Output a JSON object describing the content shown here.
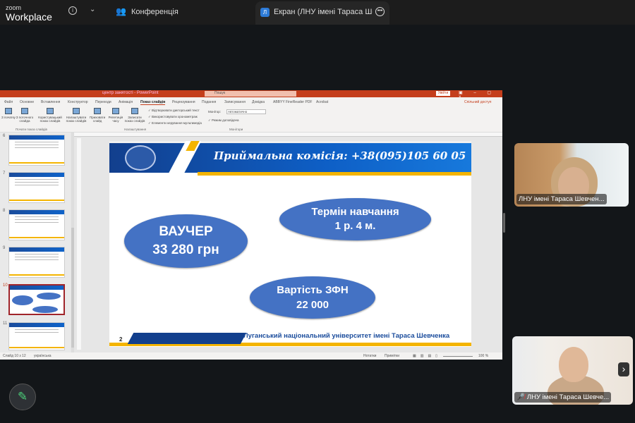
{
  "zoom": {
    "logo_small": "zoom",
    "logo_big": "Workplace",
    "meeting_label": "Конференція",
    "share_tab_initial": "Л",
    "share_tab_title": "Екран (ЛНУ імені Тараса Шевче"
  },
  "ppt": {
    "doc_title": "центр занятості - PowerPoint",
    "search_placeholder": "Пошук",
    "signin": "Увійти",
    "tabs": [
      "Файл",
      "Основне",
      "Вставлення",
      "Конструктор",
      "Переходи",
      "Анімація",
      "Показ слайдів",
      "Рецензування",
      "Подання",
      "Записування",
      "Довідка",
      "ABBYY FineReader PDF",
      "Acrobat"
    ],
    "share": "Спільний доступ",
    "ribbon": {
      "buttons": [
        "З початку",
        "З поточного слайда",
        "Користувацький показ слайдів",
        "Налаштувати показ слайдів",
        "Приховати слайд",
        "Репетиція часу",
        "Записати показ слайдів"
      ],
      "checks": [
        "Відтворювати дикторський текст",
        "Використовувати хронометраж",
        "Елементи керування мультимедіа"
      ],
      "monitor_label": "Монітор:",
      "monitor_value": "Автоматично",
      "presenter_view": "Режим доповідача",
      "groups": [
        "Почати показ слайдів",
        "Налаштування",
        "Монітори"
      ]
    },
    "thumb_numbers": [
      "6",
      "7",
      "8",
      "9",
      "10",
      "11"
    ],
    "status": {
      "slide": "Слайд 10 з 12",
      "lang": "українська",
      "notes": "Нотатки",
      "comments": "Примітки",
      "zoom": "100 %"
    }
  },
  "slide": {
    "header": "Приймальна комісія: +38(095)105 60 05",
    "voucher": [
      "ВАУЧЕР",
      "33 280 грн"
    ],
    "term": [
      "Термін навчання",
      "1 р. 4 м."
    ],
    "cost": [
      "Вартість ЗФН",
      "22 000"
    ],
    "page_number": "2",
    "university": "Луганський національний університет імені Тараса Шевченка"
  },
  "participants": [
    {
      "name": "ЛНУ імені Тараса Шевчен..."
    },
    {
      "name": "ЛНУ імені Тараса Шевче..."
    }
  ],
  "colors": {
    "ppt_accent": "#c43e1c",
    "slide_blue": "#123f8d",
    "ellipse": "#4472c4",
    "gold": "#f4b400"
  }
}
